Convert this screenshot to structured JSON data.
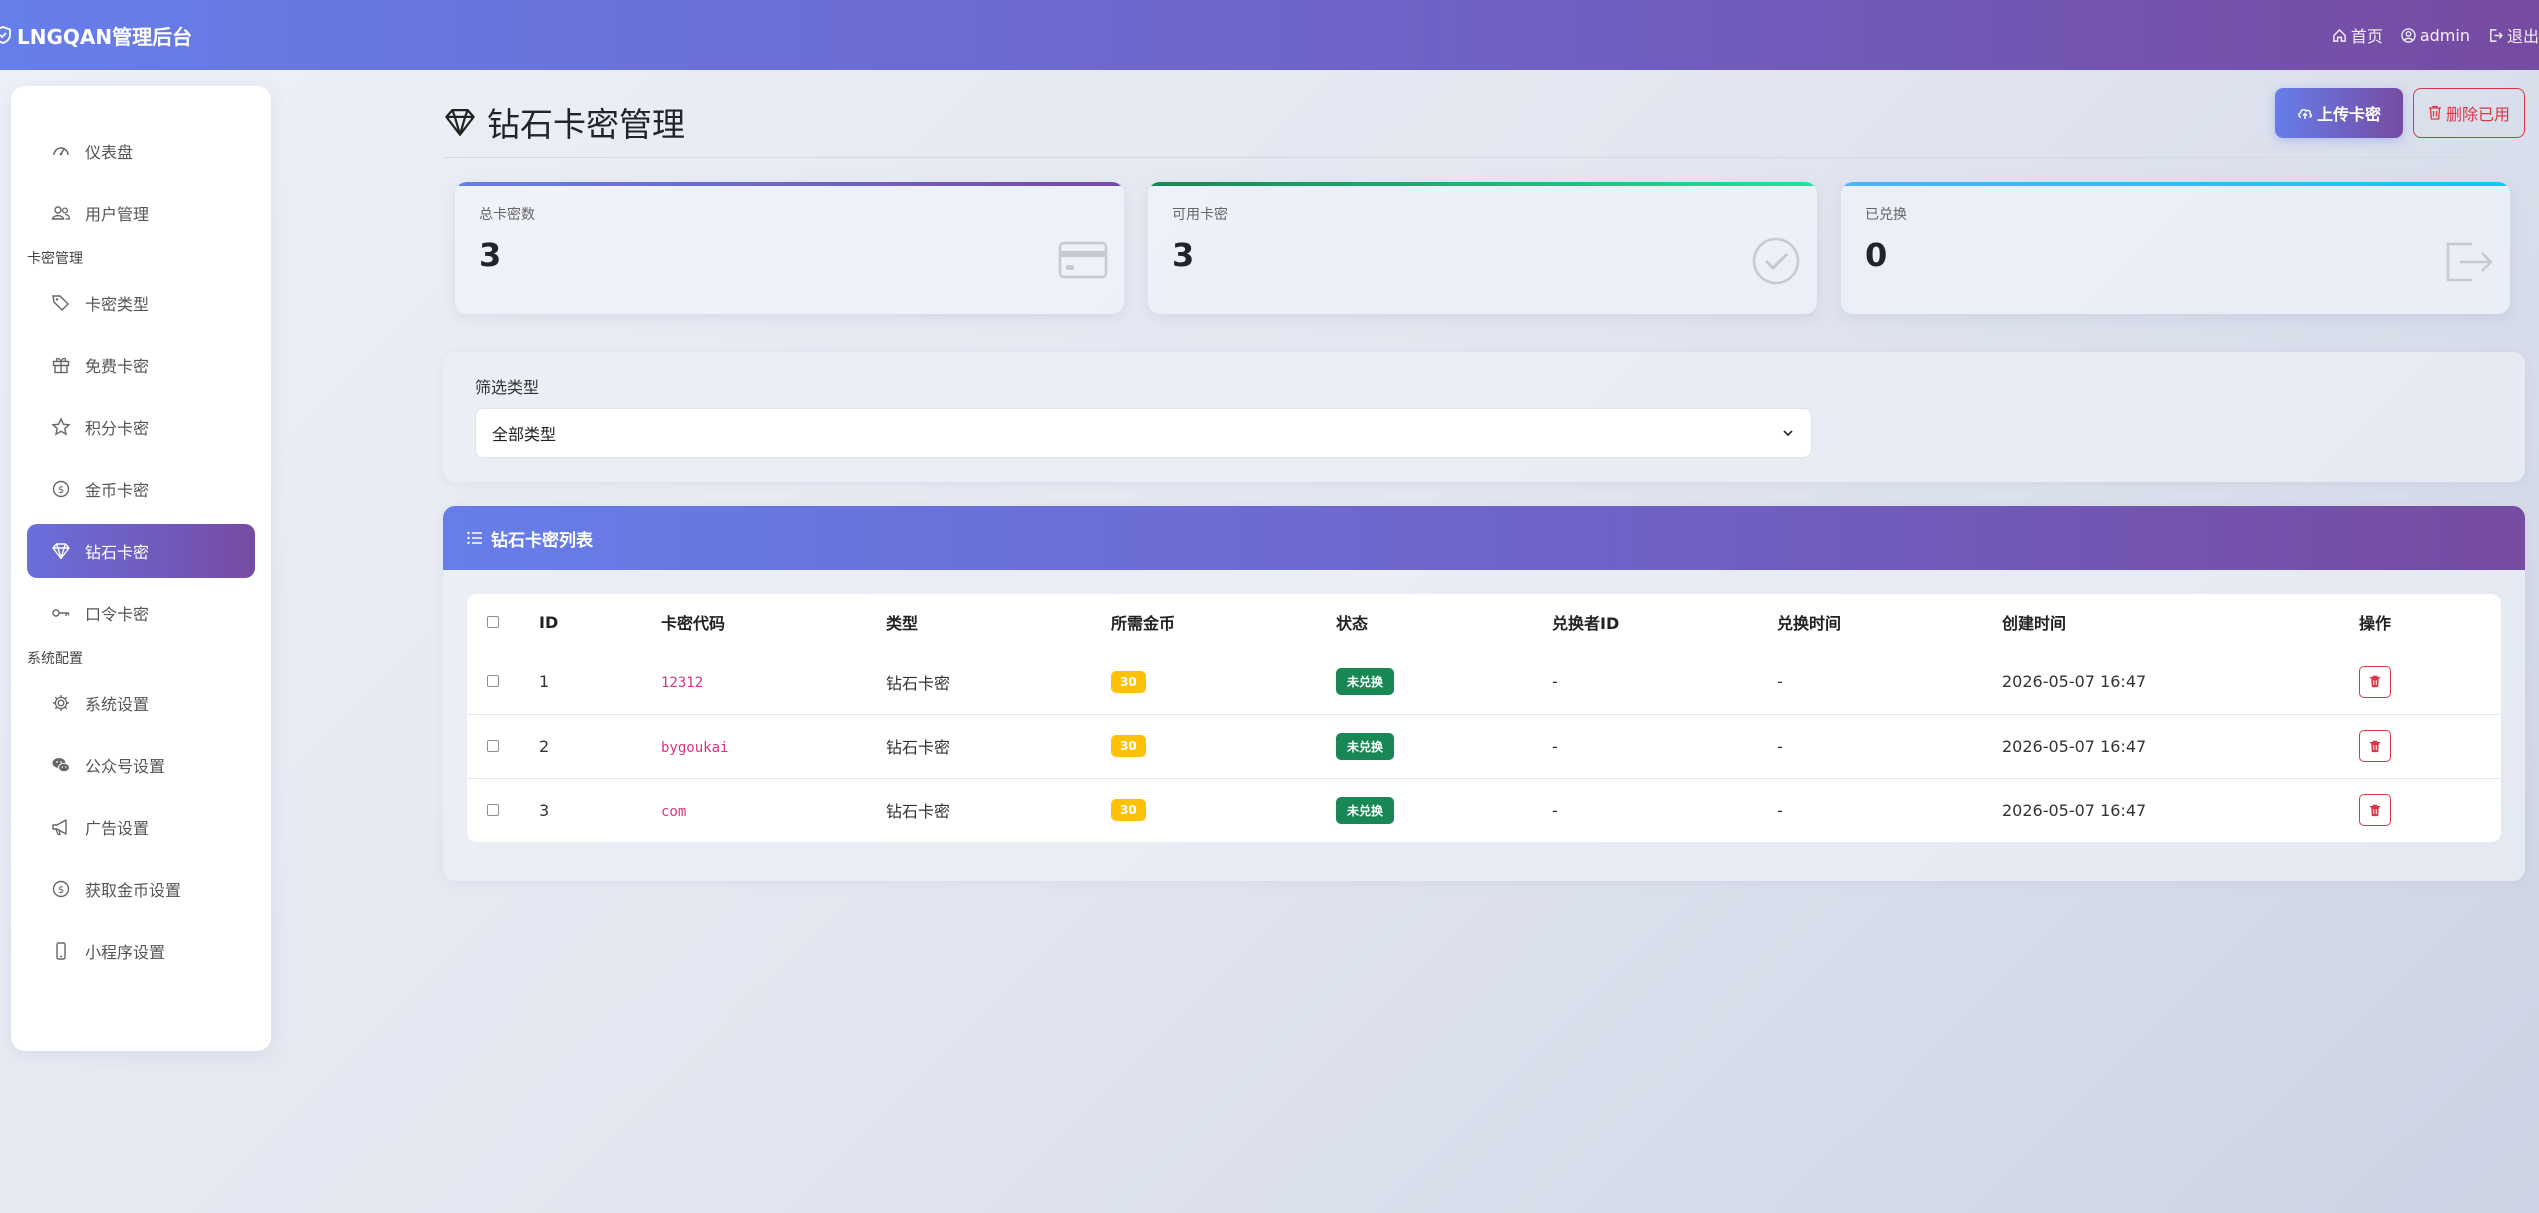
{
  "app": {
    "brand": "LNGQAN管理后台"
  },
  "nav": {
    "home": "首页",
    "user": "admin",
    "logout": "退出"
  },
  "sidebar": {
    "items_top": [
      {
        "label": "仪表盘",
        "icon": "speedometer-icon"
      },
      {
        "label": "用户管理",
        "icon": "people-icon"
      }
    ],
    "section_card": "卡密管理",
    "items_card": [
      {
        "label": "卡密类型",
        "icon": "tags-icon"
      },
      {
        "label": "免费卡密",
        "icon": "gift-icon"
      },
      {
        "label": "积分卡密",
        "icon": "star-icon"
      },
      {
        "label": "金币卡密",
        "icon": "coin-icon"
      },
      {
        "label": "钻石卡密",
        "icon": "gem-icon",
        "active": true
      },
      {
        "label": "口令卡密",
        "icon": "key-icon"
      }
    ],
    "section_system": "系统配置",
    "items_system": [
      {
        "label": "系统设置",
        "icon": "gear-icon"
      },
      {
        "label": "公众号设置",
        "icon": "wechat-icon"
      },
      {
        "label": "广告设置",
        "icon": "megaphone-icon"
      },
      {
        "label": "获取金币设置",
        "icon": "coin-icon"
      },
      {
        "label": "小程序设置",
        "icon": "phone-icon"
      }
    ]
  },
  "page": {
    "title": "钻石卡密管理",
    "upload_label": "上传卡密",
    "delete_used_label": "删除已用"
  },
  "stats": [
    {
      "label": "总卡密数",
      "value": "3",
      "color": "#6f63c7"
    },
    {
      "label": "可用卡密",
      "value": "3",
      "color": "#20c997"
    },
    {
      "label": "已兑换",
      "value": "0",
      "color": "#0dcaf0"
    }
  ],
  "filter": {
    "label": "筛选类型",
    "selected": "全部类型"
  },
  "list": {
    "title": "钻石卡密列表",
    "columns": [
      "ID",
      "卡密代码",
      "类型",
      "所需金币",
      "状态",
      "兑换者ID",
      "兑换时间",
      "创建时间",
      "操作"
    ],
    "rows": [
      {
        "id": "1",
        "code": "12312",
        "type": "钻石卡密",
        "coins": "30",
        "status": "未兑换",
        "redeemer": "-",
        "redeem_time": "-",
        "created": "2026-05-07 16:47"
      },
      {
        "id": "2",
        "code": "bygoukai",
        "type": "钻石卡密",
        "coins": "30",
        "status": "未兑换",
        "redeemer": "-",
        "redeem_time": "-",
        "created": "2026-05-07 16:47"
      },
      {
        "id": "3",
        "code": "com",
        "type": "钻石卡密",
        "coins": "30",
        "status": "未兑换",
        "redeemer": "-",
        "redeem_time": "-",
        "created": "2026-05-07 16:47"
      }
    ]
  }
}
